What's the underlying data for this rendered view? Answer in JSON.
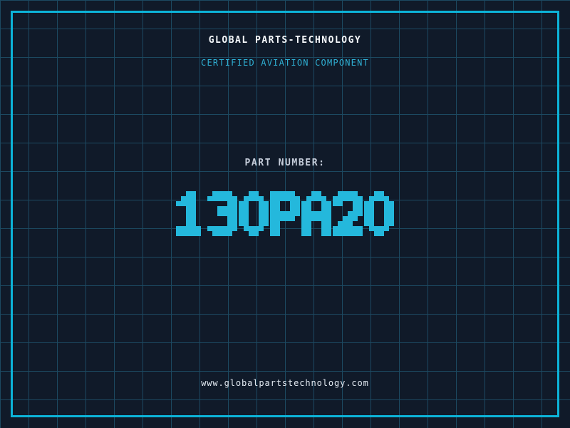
{
  "colors": {
    "background": "#101a29",
    "grid_line": "#1c4961",
    "frame": "#0cb3d8",
    "title_text": "#f5f8fb",
    "subtitle_text": "#2fb0d4",
    "label_text": "#c6cedb",
    "part_number_text": "#24b8dc",
    "url_text": "#e3eaf2"
  },
  "header": {
    "title": "GLOBAL PARTS-TECHNOLOGY",
    "subtitle": "CERTIFIED AVIATION COMPONENT"
  },
  "part": {
    "label": "PART NUMBER:",
    "value": "130PA20"
  },
  "footer": {
    "url": "www.globalpartstechnology.com"
  }
}
